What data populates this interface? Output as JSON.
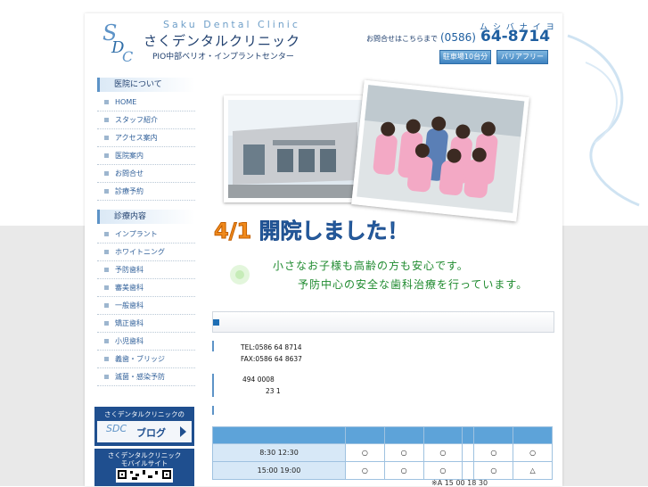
{
  "header": {
    "logo_en": "Saku Dental Clinic",
    "logo_mark": "SDC",
    "logo_jp": "さくデンタルクリニック",
    "logo_sub": "PIO中部ベリオ・インプラントセンター",
    "inquiry": "お問合せはこちらまで",
    "tel_kana": "ムシバナイヨ",
    "tel_prefix": "(0586)",
    "tel_number": "64-8714",
    "badge_parking": "駐車場10台分",
    "badge_barrierfree": "バリアフリー"
  },
  "sidebar": {
    "section1_title": "医院について",
    "section1_items": [
      "HOME",
      "スタッフ紹介",
      "アクセス案内",
      "医院案内",
      "お問合せ",
      "診療予約"
    ],
    "section2_title": "診療内容",
    "section2_items": [
      "インプラント",
      "ホワイトニング",
      "予防歯科",
      "審美歯科",
      "一般歯科",
      "矯正歯科",
      "小児歯科",
      "義歯・ブリッジ",
      "滅菌・感染予防"
    ],
    "blog_caption": "さくデンタルクリニックの",
    "blog_label": "ブログ",
    "mobile_caption": "さくデンタルクリニック\nモバイルサイト"
  },
  "hero": {
    "date": "4/1",
    "opened": "開院しました！",
    "message1": "小さなお子様も高齢の方も安心です。",
    "message2": "予防中心の安全な歯科治療を行っています。"
  },
  "info": {
    "tel": "TEL:0586 64 8714",
    "fax": "FAX:0586 64 8637",
    "zip": "494 0008",
    "address": "23 1"
  },
  "schedule": {
    "rows": [
      {
        "time": "8:30 12:30",
        "marks": [
          "○",
          "○",
          "○",
          "",
          "○",
          "○"
        ]
      },
      {
        "time": "15:00 19:00",
        "marks": [
          "○",
          "○",
          "○",
          "",
          "○",
          "△"
        ]
      }
    ],
    "note": "※A 15 00 18 30"
  },
  "colors": {
    "accent": "#1f4f8f",
    "light_blue": "#5da3d9",
    "green_text": "#1e8a2e",
    "orange": "#f08a1c"
  }
}
